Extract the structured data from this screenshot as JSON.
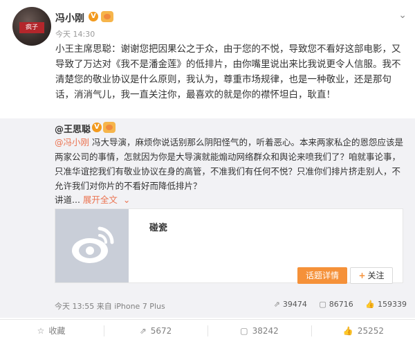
{
  "author": {
    "name": "冯小刚",
    "avatar_stamp": "疯子"
  },
  "post": {
    "timestamp": "今天 14:30",
    "text": "小王主席思聪：谢谢您把因果公之于众，由于您的不悦，导致您不看好这部电影，又导致了万达对《我不是潘金莲》的低排片，由你嘴里说出来比我说更令人信服。我不清楚您的敬业协议是什么原则，我认为，尊重市场规律，也是一种敬业，还是那句话，消消气儿，我一直关注你，最喜欢的就是你的襟怀坦白，耿直！"
  },
  "repost": {
    "author": "@王思聪",
    "mention": "@冯小刚",
    "text": " 冯大导演，麻烦你说话别那么阴阳怪气的，听着恶心。本来两家私企的恩怨应该是两家公司的事情，怎就因为你是大导演就能煽动网络群众和舆论来喷我们了？咱就事论事，只准华谊挖我们有敬业协议在身的高管，不准我们有任何不悦？只准你们排片挤走别人，不允许我们对你片的不看好而降低排片？",
    "truncated": "讲道...",
    "expand_label": "展开全文",
    "card": {
      "title": "碰瓷",
      "topic_button": "话题详情",
      "follow_button": "关注"
    },
    "footer": "今天 13:55 来自 iPhone 7 Plus",
    "stats": {
      "reposts": "39474",
      "comments": "86716",
      "likes": "159339"
    }
  },
  "actions": {
    "favorite": "收藏",
    "repost": "5672",
    "comment": "38242",
    "like": "25252"
  }
}
